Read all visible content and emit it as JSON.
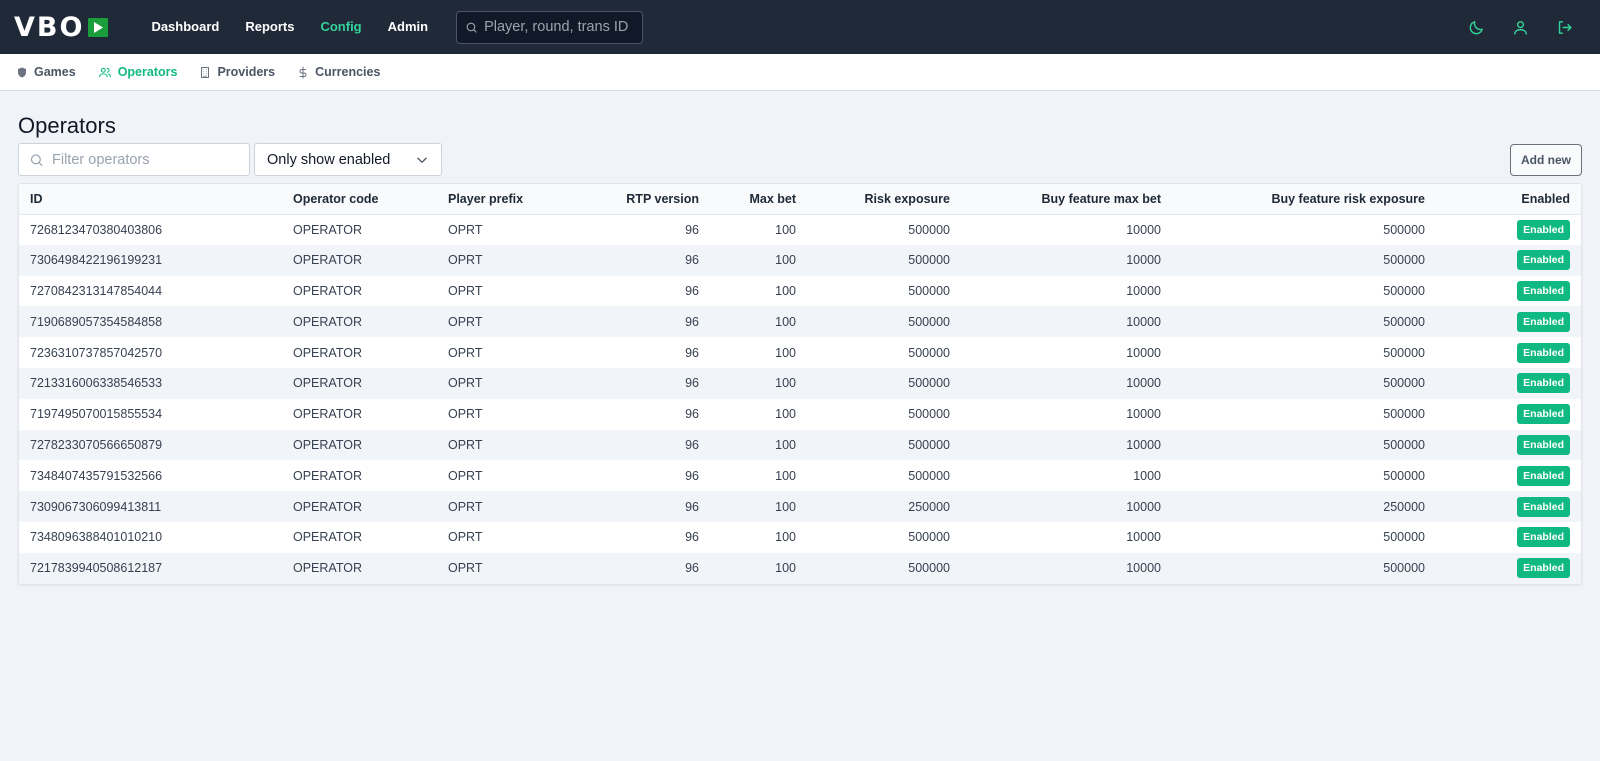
{
  "app": {
    "logo_text": "VBO",
    "nav": [
      {
        "label": "Dashboard",
        "active": false
      },
      {
        "label": "Reports",
        "active": false
      },
      {
        "label": "Config",
        "active": true
      },
      {
        "label": "Admin",
        "active": false
      }
    ],
    "search": {
      "placeholder": "Player, round, trans ID",
      "value": ""
    },
    "icons": [
      "moon-icon",
      "user-icon",
      "logout-icon"
    ]
  },
  "subnav": {
    "items": [
      {
        "label": "Games",
        "icon": "shield-icon",
        "active": false
      },
      {
        "label": "Operators",
        "icon": "users-icon",
        "active": true
      },
      {
        "label": "Providers",
        "icon": "building-icon",
        "active": false
      },
      {
        "label": "Currencies",
        "icon": "dollar-icon",
        "active": false
      }
    ]
  },
  "page": {
    "title": "Operators",
    "filter": {
      "placeholder": "Filter operators",
      "value": ""
    },
    "select": {
      "selected": "Only show enabled"
    },
    "add_button": "Add new"
  },
  "colors": {
    "accent": "#10b981",
    "topbar": "#1f2937",
    "logo_green": "#1a9e3c"
  },
  "table": {
    "columns": [
      "ID",
      "Operator code",
      "Player prefix",
      "RTP version",
      "Max bet",
      "Risk exposure",
      "Buy feature max bet",
      "Buy feature risk exposure",
      "Enabled"
    ],
    "rows": [
      [
        "7268123470380403806",
        "OPERATOR",
        "OPRT",
        "96",
        "100",
        "500000",
        "10000",
        "500000",
        "Enabled"
      ],
      [
        "7306498422196199231",
        "OPERATOR",
        "OPRT",
        "96",
        "100",
        "500000",
        "10000",
        "500000",
        "Enabled"
      ],
      [
        "7270842313147854044",
        "OPERATOR",
        "OPRT",
        "96",
        "100",
        "500000",
        "10000",
        "500000",
        "Enabled"
      ],
      [
        "7190689057354584858",
        "OPERATOR",
        "OPRT",
        "96",
        "100",
        "500000",
        "10000",
        "500000",
        "Enabled"
      ],
      [
        "7236310737857042570",
        "OPERATOR",
        "OPRT",
        "96",
        "100",
        "500000",
        "10000",
        "500000",
        "Enabled"
      ],
      [
        "7213316006338546533",
        "OPERATOR",
        "OPRT",
        "96",
        "100",
        "500000",
        "10000",
        "500000",
        "Enabled"
      ],
      [
        "7197495070015855534",
        "OPERATOR",
        "OPRT",
        "96",
        "100",
        "500000",
        "10000",
        "500000",
        "Enabled"
      ],
      [
        "7278233070566650879",
        "OPERATOR",
        "OPRT",
        "96",
        "100",
        "500000",
        "10000",
        "500000",
        "Enabled"
      ],
      [
        "7348407435791532566",
        "OPERATOR",
        "OPRT",
        "96",
        "100",
        "500000",
        "1000",
        "500000",
        "Enabled"
      ],
      [
        "7309067306099413811",
        "OPERATOR",
        "OPRT",
        "96",
        "100",
        "250000",
        "10000",
        "250000",
        "Enabled"
      ],
      [
        "7348096388401010210",
        "OPERATOR",
        "OPRT",
        "96",
        "100",
        "500000",
        "10000",
        "500000",
        "Enabled"
      ],
      [
        "7217839940508612187",
        "OPERATOR",
        "OPRT",
        "96",
        "100",
        "500000",
        "10000",
        "500000",
        "Enabled"
      ]
    ]
  }
}
